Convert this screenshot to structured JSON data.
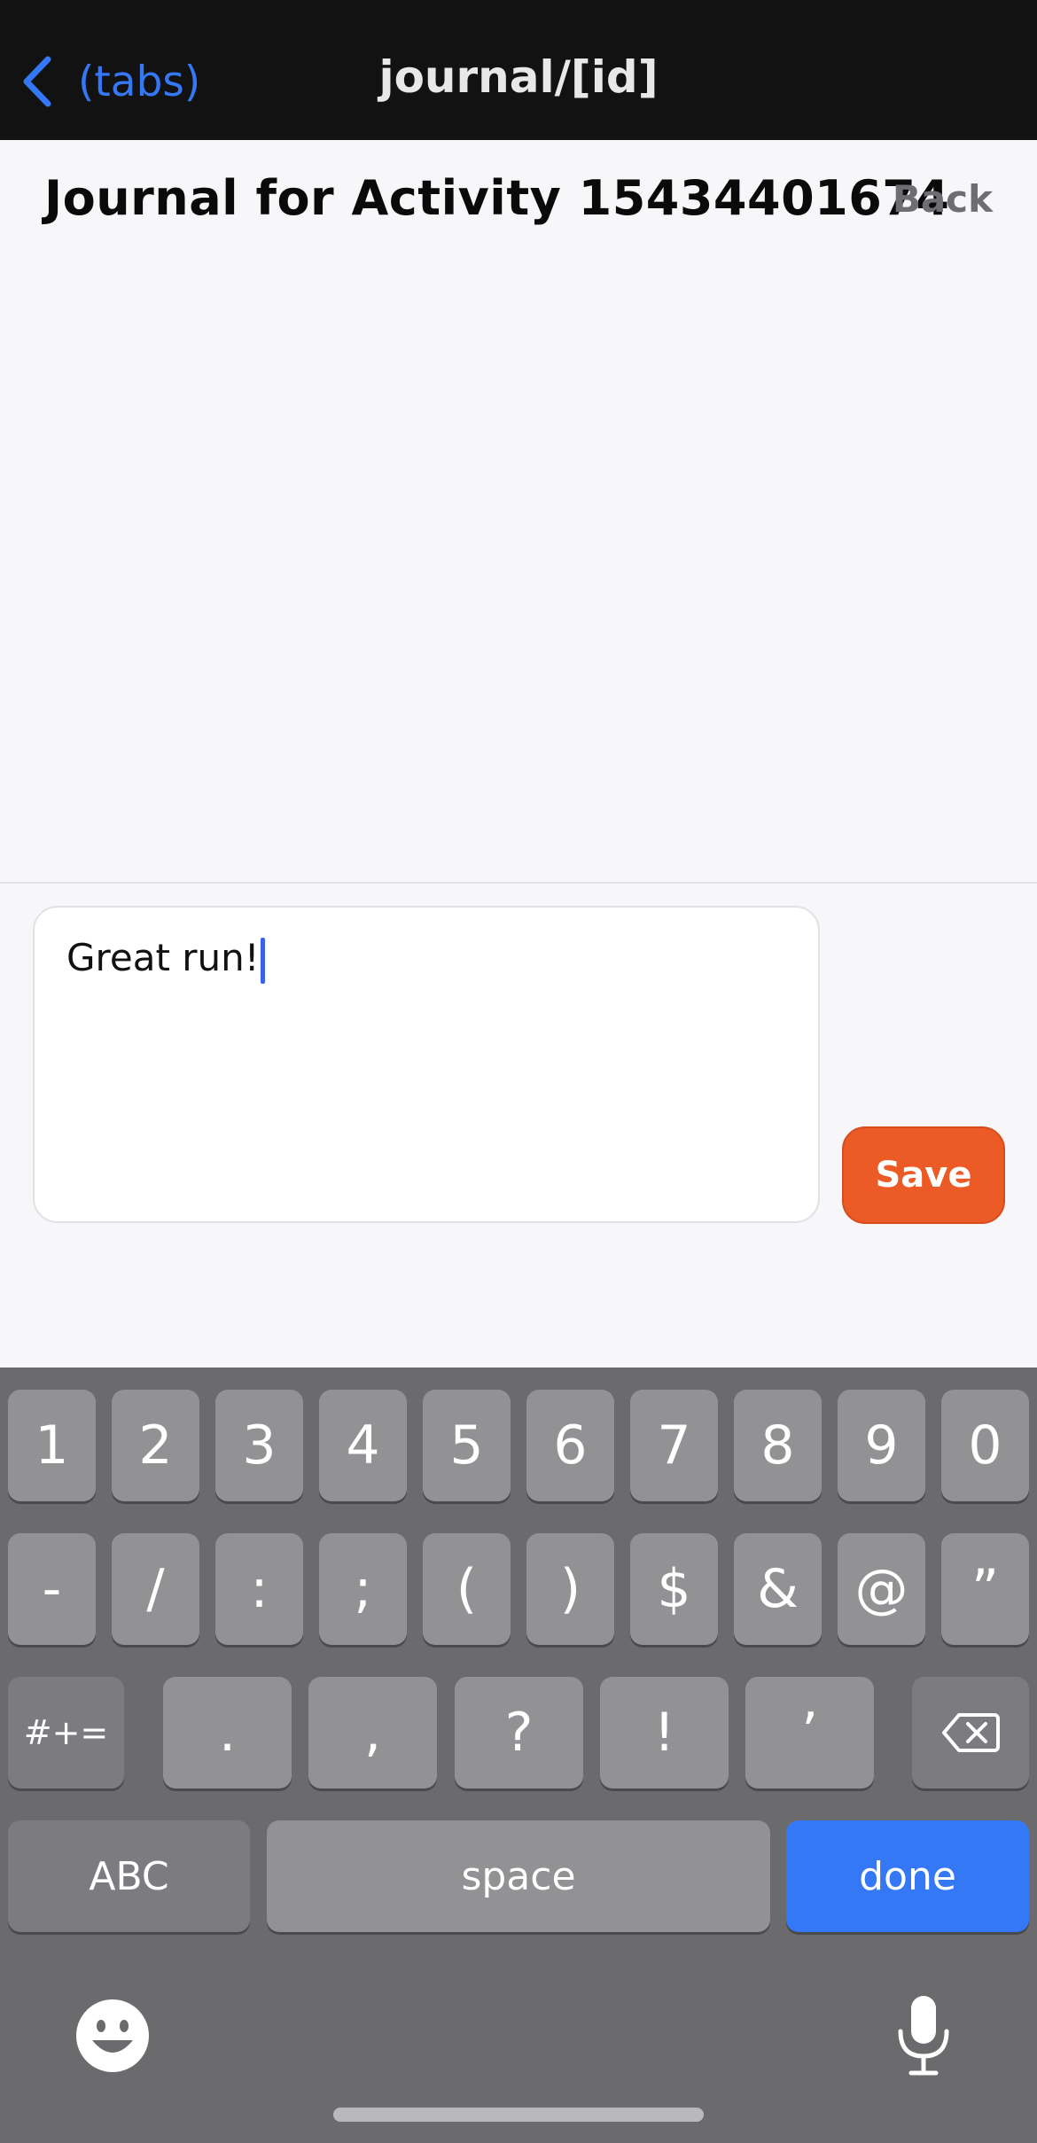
{
  "navbar": {
    "back_label": "(tabs)",
    "title": "journal/[id]"
  },
  "header": {
    "title": "Journal for Activity 15434401674",
    "back_label": "Back"
  },
  "composer": {
    "text": "Great run!",
    "save_label": "Save"
  },
  "keyboard": {
    "row1": [
      "1",
      "2",
      "3",
      "4",
      "5",
      "6",
      "7",
      "8",
      "9",
      "0"
    ],
    "row2": [
      "-",
      "/",
      ":",
      ";",
      "(",
      ")",
      "$",
      "&",
      "@",
      "”"
    ],
    "row3_left": "#+=",
    "row3": [
      ".",
      ",",
      "?",
      "!",
      "’"
    ],
    "abc_label": "ABC",
    "space_label": "space",
    "done_label": "done"
  },
  "colors": {
    "accent": "#3478f6",
    "save": "#ec5a26",
    "keyboard_bg": "#6b6b6e"
  }
}
